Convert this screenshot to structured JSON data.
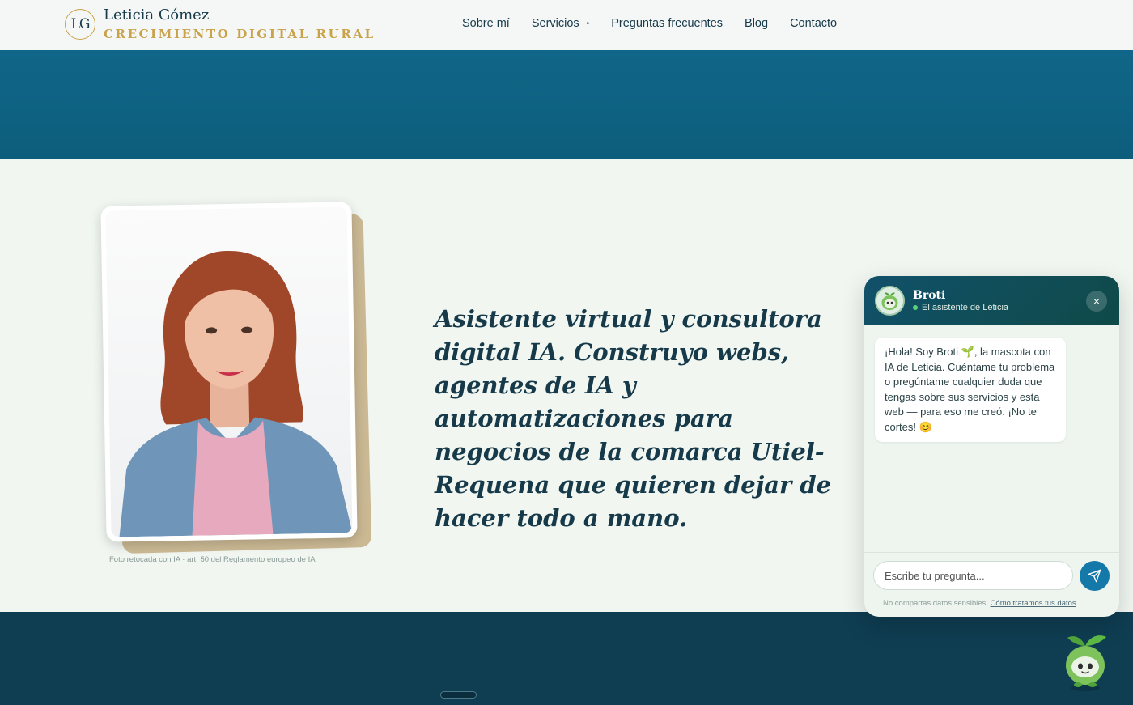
{
  "header": {
    "logo_initials": "LG",
    "brand_name": "Leticia Gómez",
    "brand_tagline": "CRECIMIENTO DIGITAL RURAL",
    "nav": [
      {
        "label": "Sobre mí"
      },
      {
        "label": "Servicios"
      },
      {
        "label": "Preguntas frecuentes"
      },
      {
        "label": "Blog"
      },
      {
        "label": "Contacto"
      }
    ]
  },
  "hero": {
    "photo_caption": "Foto retocada con IA · art. 50 del Reglamento europeo de IA",
    "headline": "Asistente virtual y consultora digital IA. Construyo webs, agentes de IA y automatizaciones para negocios de la comarca Utiel-Requena que quieren dejar de hacer todo a mano."
  },
  "chat": {
    "name": "Broti",
    "status": "El asistente de Leticia",
    "close_label": "×",
    "message": "¡Hola! Soy Broti 🌱, la mascota con IA de Leticia. Cuéntame tu problema o pregúntame cualquier duda que tengas sobre sus servicios y esta web — para eso me creó. ¡No te cortes! 😊",
    "input_placeholder": "Escribe tu pregunta...",
    "note_text": "No compartas datos sensibles. ",
    "note_link": "Cómo tratamos tus datos"
  },
  "colors": {
    "brand_dark": "#173a4a",
    "gold": "#c9a24a",
    "band_blue": "#106688",
    "footer_dark": "#0f3d52",
    "send_blue": "#1478a8"
  }
}
